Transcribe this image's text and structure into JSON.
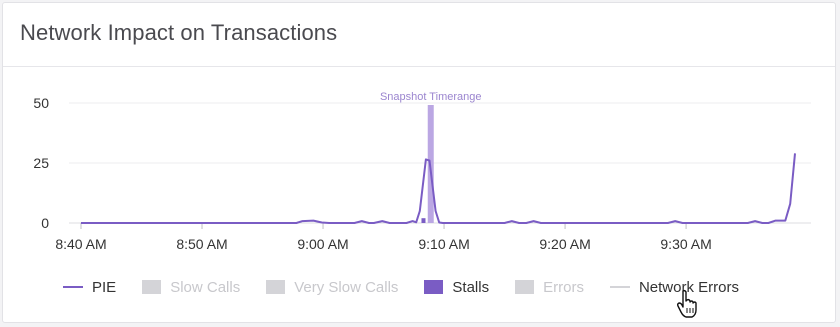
{
  "panel": {
    "title": "Network Impact on Transactions"
  },
  "colors": {
    "pie": "#7a5cc4",
    "stalls": "#7a5cc4",
    "snapshot_bar": "#bba7e3",
    "snapshot_label": "#9b85cf",
    "disabled": "#d4d4d8",
    "grid": "#ececef",
    "axis_text": "#333333"
  },
  "chart_data": {
    "type": "line",
    "title": "Network Impact on Transactions",
    "xlabel": "",
    "ylabel": "",
    "ylim": [
      0,
      50
    ],
    "yticks": [
      "0",
      "25",
      "50"
    ],
    "xlim": [
      0,
      59
    ],
    "xticks": [
      {
        "t": 0,
        "label": "8:40 AM"
      },
      {
        "t": 10,
        "label": "8:50 AM"
      },
      {
        "t": 20,
        "label": "9:00 AM"
      },
      {
        "t": 30,
        "label": "9:10 AM"
      },
      {
        "t": 40,
        "label": "9:20 AM"
      },
      {
        "t": 50,
        "label": "9:30 AM"
      }
    ],
    "grid": true,
    "legend_position": "bottom",
    "annotation": {
      "label": "Snapshot Timerange",
      "t": 28.9
    },
    "series": [
      {
        "name": "PIE",
        "points": [
          [
            0,
            0
          ],
          [
            17.8,
            0
          ],
          [
            18.3,
            0.8
          ],
          [
            19.2,
            1.0
          ],
          [
            19.9,
            0.2
          ],
          [
            20.5,
            0
          ],
          [
            22.6,
            0
          ],
          [
            23.2,
            0.8
          ],
          [
            23.8,
            0
          ],
          [
            24.2,
            0
          ],
          [
            24.9,
            0.8
          ],
          [
            25.5,
            0
          ],
          [
            26.9,
            0
          ],
          [
            27.4,
            0.8
          ],
          [
            27.7,
            0.3
          ],
          [
            28,
            5
          ],
          [
            28.5,
            26.5
          ],
          [
            28.8,
            26
          ],
          [
            29.3,
            5
          ],
          [
            29.6,
            0.2
          ],
          [
            29.9,
            0
          ],
          [
            35,
            0
          ],
          [
            35.6,
            0.8
          ],
          [
            36.2,
            0
          ],
          [
            36.8,
            0
          ],
          [
            37.4,
            0.8
          ],
          [
            38,
            0
          ],
          [
            48.5,
            0
          ],
          [
            49.1,
            0.8
          ],
          [
            49.7,
            0
          ],
          [
            55.1,
            0
          ],
          [
            55.7,
            0.8
          ],
          [
            56.3,
            0
          ],
          [
            56.8,
            0
          ],
          [
            57.4,
            1
          ],
          [
            58.2,
            1
          ],
          [
            58.6,
            8
          ],
          [
            59,
            29
          ]
        ]
      },
      {
        "name": "Slow Calls",
        "enabled": false
      },
      {
        "name": "Very Slow Calls",
        "enabled": false
      },
      {
        "name": "Stalls",
        "bars": [
          {
            "t": 28.3,
            "value": 2
          }
        ]
      },
      {
        "name": "Errors",
        "enabled": false
      },
      {
        "name": "Network Errors",
        "points": []
      }
    ]
  },
  "legend": [
    {
      "label": "PIE",
      "swatch": "line",
      "color": "#7a5cc4",
      "enabled": true
    },
    {
      "label": "Slow Calls",
      "swatch": "box",
      "color": "#d4d4d8",
      "enabled": false
    },
    {
      "label": "Very Slow Calls",
      "swatch": "box",
      "color": "#d4d4d8",
      "enabled": false
    },
    {
      "label": "Stalls",
      "swatch": "box",
      "color": "#7a5cc4",
      "enabled": true
    },
    {
      "label": "Errors",
      "swatch": "box",
      "color": "#d4d4d8",
      "enabled": false
    },
    {
      "label": "Network Errors",
      "swatch": "line",
      "color": "#d4d4d8",
      "enabled": true
    }
  ]
}
